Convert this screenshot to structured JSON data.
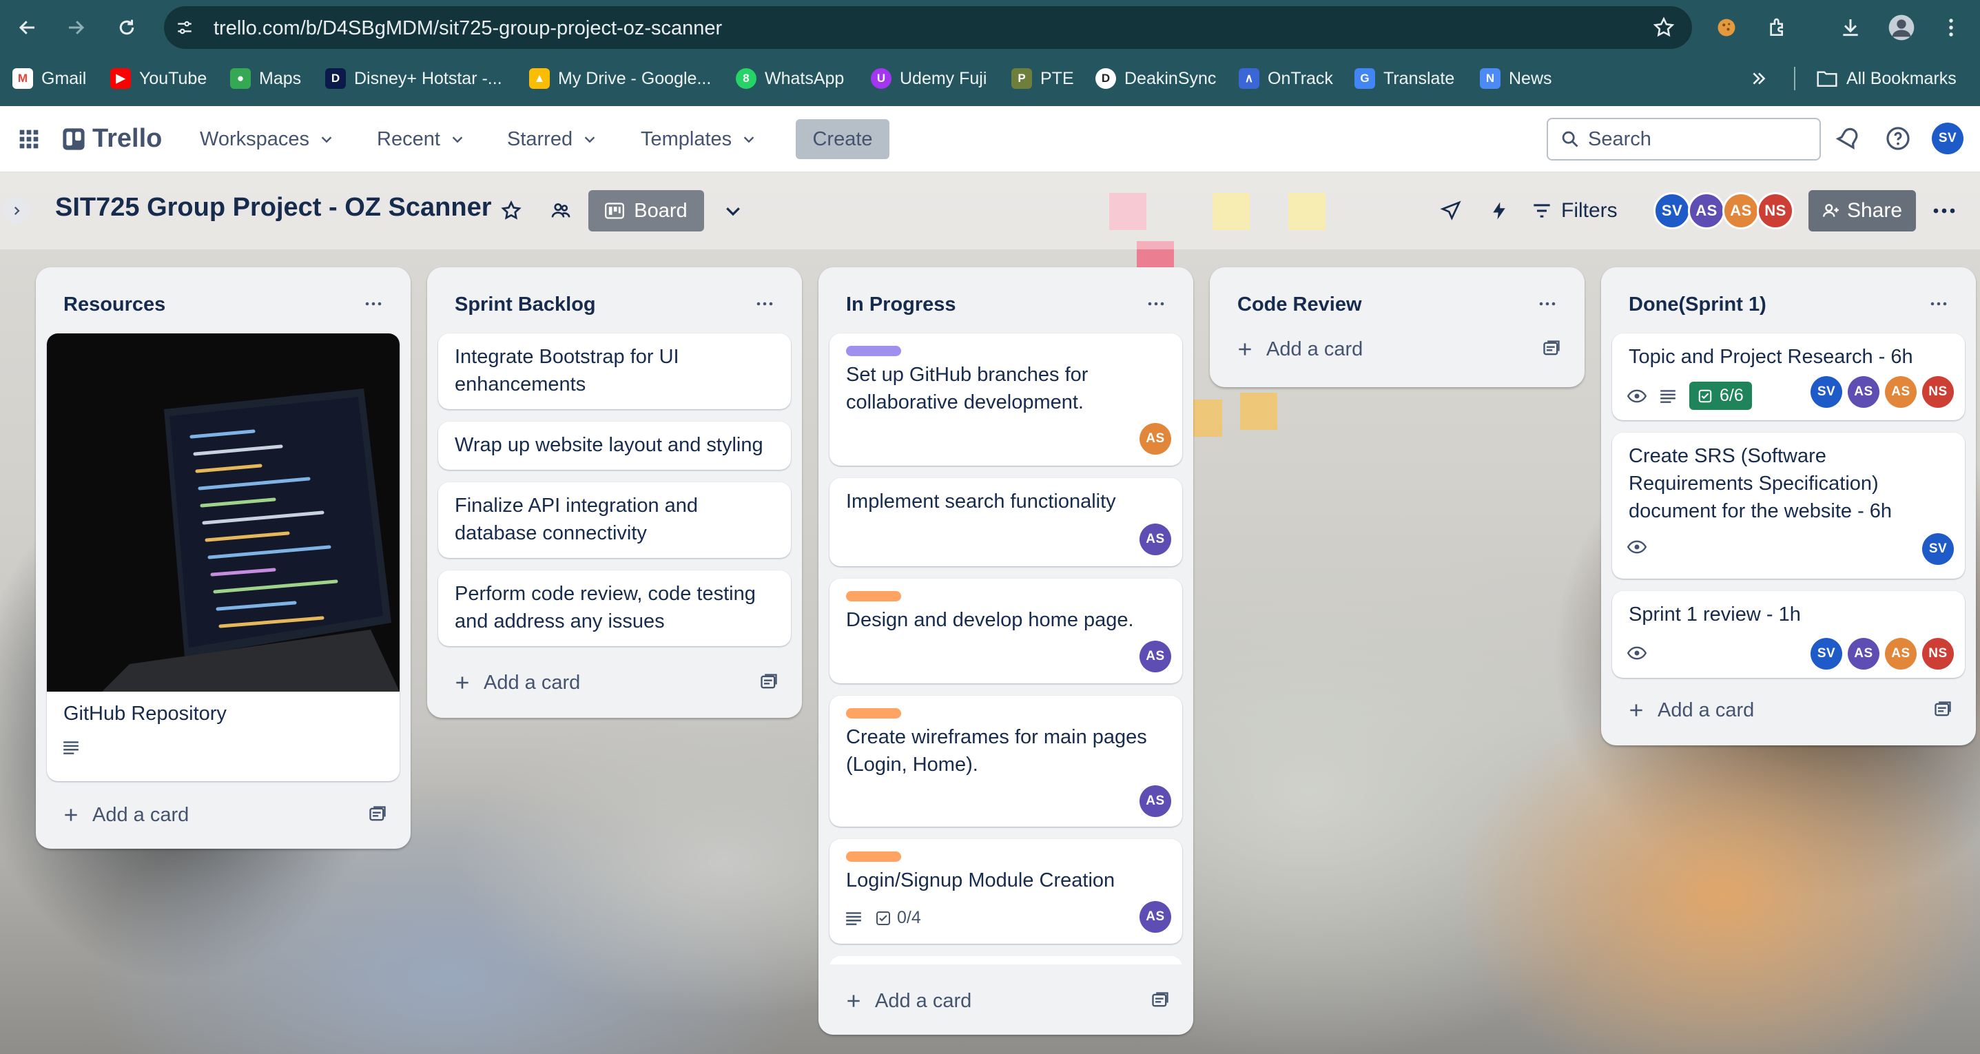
{
  "browser": {
    "url": "trello.com/b/D4SBgMDM/sit725-group-project-oz-scanner",
    "bookmarks": [
      "Gmail",
      "YouTube",
      "Maps",
      "Disney+ Hotstar -...",
      "My Drive - Google...",
      "WhatsApp",
      "Udemy Fuji",
      "PTE",
      "DeakinSync",
      "OnTrack",
      "Translate",
      "News"
    ],
    "all_bookmarks": "All Bookmarks"
  },
  "app": {
    "logo": "Trello",
    "menus": [
      "Workspaces",
      "Recent",
      "Starred",
      "Templates"
    ],
    "create_label": "Create",
    "search_placeholder": "Search",
    "user_initials": "SV"
  },
  "board": {
    "title": "SIT725 Group Project - OZ Scanner",
    "view_label": "Board",
    "filters_label": "Filters",
    "share_label": "Share",
    "members": [
      "SV",
      "AS",
      "AS",
      "NS"
    ]
  },
  "colors": {
    "chrome": "#25565f",
    "label_purple": "#9f8fef",
    "label_orange": "#fea362",
    "label_yellow": "#f5cd47",
    "checklist_done": "#1f845a"
  },
  "lists": [
    {
      "title": "Resources",
      "add_card": "Add a card",
      "cards": [
        {
          "title": "GitHub Repository",
          "has_cover": true,
          "has_description": true
        }
      ]
    },
    {
      "title": "Sprint Backlog",
      "add_card": "Add a card",
      "cards": [
        {
          "title": "Integrate Bootstrap for UI enhancements"
        },
        {
          "title": "Wrap up website layout and styling"
        },
        {
          "title": "Finalize API integration and database connectivity"
        },
        {
          "title": "Perform code review, code testing and address any issues"
        }
      ]
    },
    {
      "title": "In Progress",
      "add_card": "Add a card",
      "cards": [
        {
          "title": "Set up GitHub branches for collaborative development.",
          "label": "purple",
          "members": [
            "AS"
          ]
        },
        {
          "title": "Implement search functionality",
          "members": [
            "AS"
          ]
        },
        {
          "title": "Design and develop home page.",
          "label": "orange",
          "members": [
            "AS"
          ]
        },
        {
          "title": "Create wireframes for main pages (Login, Home).",
          "label": "orange",
          "members": [
            "AS"
          ]
        },
        {
          "title": "Login/Signup Module Creation",
          "label": "orange",
          "checklist": "0/4",
          "members": [
            "AS"
          ]
        }
      ]
    },
    {
      "title": "Code Review",
      "add_card": "Add a card",
      "cards": []
    },
    {
      "title": "Done(Sprint 1)",
      "add_card": "Add a card",
      "cards": [
        {
          "title": "Topic and Project Research - 6h",
          "checklist": "6/6",
          "members": [
            "SV",
            "AS",
            "AS",
            "NS"
          ]
        },
        {
          "title": "Create SRS (Software Requirements Specification) document for the website - 6h",
          "members": [
            "SV"
          ]
        },
        {
          "title": "Sprint 1 review - 1h",
          "members": [
            "SV",
            "AS",
            "AS",
            "NS"
          ]
        }
      ]
    }
  ]
}
